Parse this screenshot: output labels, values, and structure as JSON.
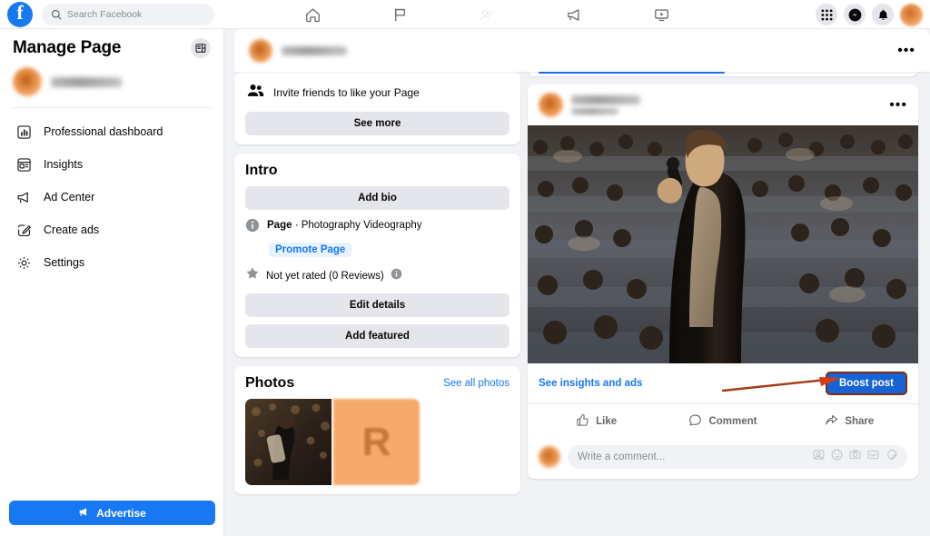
{
  "topbar": {
    "logo": "facebook-logo",
    "search": {
      "placeholder": "Search Facebook",
      "icon": "search-icon"
    },
    "center_icons": [
      "home-icon",
      "flag-icon",
      "groups-icon-faded",
      "megaphone-icon",
      "video-icon"
    ],
    "right_icons": [
      "grid-menu-icon",
      "messenger-icon",
      "notifications-bell-icon",
      "profile-avatar"
    ]
  },
  "sidebar": {
    "title": "Manage Page",
    "collapse_icon": "panel-collapse-icon",
    "page_name_redacted": true,
    "items": [
      {
        "label": "Professional dashboard",
        "icon": "bar-chart-icon"
      },
      {
        "label": "Insights",
        "icon": "insights-panel-icon"
      },
      {
        "label": "Ad Center",
        "icon": "megaphone-icon"
      },
      {
        "label": "Create ads",
        "icon": "pencil-square-icon"
      },
      {
        "label": "Settings",
        "icon": "gear-icon"
      }
    ],
    "advertise_button": {
      "label": "Advertise",
      "icon": "megaphone-icon",
      "color": "#1877f2"
    }
  },
  "page_header": {
    "page_name_redacted": true,
    "menu_icon": "ellipsis-icon"
  },
  "center": {
    "invite": {
      "label": "Invite friends to like your Page",
      "icon": "friends-icon"
    },
    "see_more_label": "See more",
    "intro": {
      "title": "Intro",
      "add_bio_label": "Add bio",
      "category_bold": "Page",
      "category_rest": " · Photography Videography",
      "info_icon": "info-icon",
      "promote_label": "Promote Page",
      "rating_text": "Not yet rated (0 Reviews)",
      "star_icon": "star-icon",
      "rating_info_icon": "info-icon",
      "edit_details_label": "Edit details",
      "add_featured_label": "Add featured"
    },
    "photos": {
      "title": "Photos",
      "see_all_label": "See all photos",
      "thumbs": [
        {
          "type": "photo",
          "alt": "person-with-camera-photo"
        },
        {
          "type": "letter-tile",
          "letter": "R",
          "color": "#f5a96a"
        }
      ]
    }
  },
  "feed": {
    "tabs_partial": true,
    "post": {
      "page_name_redacted": true,
      "timestamp_redacted": true,
      "menu_icon": "ellipsis-icon",
      "image_alt": "speaker-on-stage-with-microphone-before-audience",
      "insights_link": "See insights and ads",
      "boost_label": "Boost post",
      "boost_color": "#1863d4",
      "boost_highlight_color": "#7d2b16",
      "annotation": {
        "type": "arrow",
        "color": "#a33a17",
        "points_to": "boost-post-button"
      },
      "actions": [
        {
          "label": "Like",
          "icon": "thumbs-up-icon"
        },
        {
          "label": "Comment",
          "icon": "comment-bubble-icon"
        },
        {
          "label": "Share",
          "icon": "share-arrow-icon"
        }
      ],
      "comment_placeholder": "Write a comment...",
      "comment_icons": [
        "emoji-avatar-icon",
        "smiley-icon",
        "camera-icon",
        "gif-icon",
        "sticker-icon"
      ]
    }
  }
}
